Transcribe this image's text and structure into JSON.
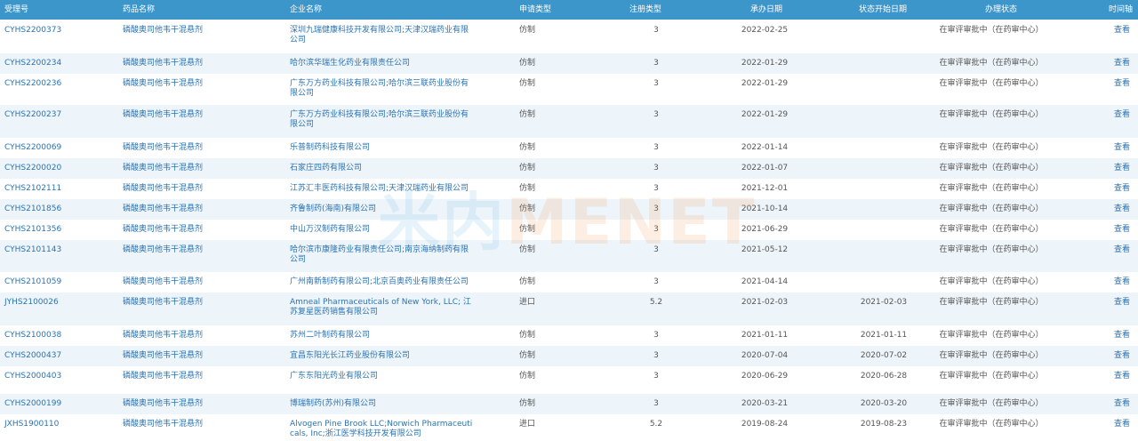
{
  "header": {
    "accept_no": "受理号",
    "drug_name": "药品名称",
    "company": "企业名称",
    "app_type": "申请类型",
    "reg_type": "注册类型",
    "undertake_date": "承办日期",
    "state_start": "状态开始日期",
    "status": "办理状态",
    "timeline": "时间轴"
  },
  "watermark": {
    "part1": "米内",
    "part2": "MENET"
  },
  "rows": [
    {
      "id": "CYHS2200373",
      "drug": "磷酸奥司他韦干混悬剂",
      "company": "深圳九瑞健康科技开发有限公司;天津汉瑞药业有限公司",
      "type": "仿制",
      "reg": "3",
      "date": "2022-02-25",
      "state": "",
      "status": "在审评审批中（在药审中心）",
      "view": "查看"
    },
    {
      "id": "CYHS2200234",
      "drug": "磷酸奥司他韦干混悬剂",
      "company": "哈尔滨华瑞生化药业有限责任公司",
      "type": "仿制",
      "reg": "3",
      "date": "2022-01-29",
      "state": "",
      "status": "在审评审批中（在药审中心）",
      "view": "查看"
    },
    {
      "id": "CYHS2200236",
      "drug": "磷酸奥司他韦干混悬剂",
      "company": "广东万方药业科技有限公司;哈尔滨三联药业股份有限公司",
      "type": "仿制",
      "reg": "3",
      "date": "2022-01-29",
      "state": "",
      "status": "在审评审批中（在药审中心）",
      "view": "查看"
    },
    {
      "id": "CYHS2200237",
      "drug": "磷酸奥司他韦干混悬剂",
      "company": "广东万方药业科技有限公司;哈尔滨三联药业股份有限公司",
      "type": "仿制",
      "reg": "3",
      "date": "2022-01-29",
      "state": "",
      "status": "在审评审批中（在药审中心）",
      "view": "查看"
    },
    {
      "id": "CYHS2200069",
      "drug": "磷酸奥司他韦干混悬剂",
      "company": "乐普制药科技有限公司",
      "type": "仿制",
      "reg": "3",
      "date": "2022-01-14",
      "state": "",
      "status": "在审评审批中（在药审中心）",
      "view": "查看"
    },
    {
      "id": "CYHS2200020",
      "drug": "磷酸奥司他韦干混悬剂",
      "company": "石家庄四药有限公司",
      "type": "仿制",
      "reg": "3",
      "date": "2022-01-07",
      "state": "",
      "status": "在审评审批中（在药审中心）",
      "view": "查看"
    },
    {
      "id": "CYHS2102111",
      "drug": "磷酸奥司他韦干混悬剂",
      "company": "江苏汇丰医药科技有限公司;天津汉瑞药业有限公司",
      "type": "仿制",
      "reg": "3",
      "date": "2021-12-01",
      "state": "",
      "status": "在审评审批中（在药审中心）",
      "view": "查看"
    },
    {
      "id": "CYHS2101856",
      "drug": "磷酸奥司他韦干混悬剂",
      "company": "齐鲁制药(海南)有限公司",
      "type": "仿制",
      "reg": "3",
      "date": "2021-10-14",
      "state": "",
      "status": "在审评审批中（在药审中心）",
      "view": "查看"
    },
    {
      "id": "CYHS2101356",
      "drug": "磷酸奥司他韦干混悬剂",
      "company": "中山万汉制药有限公司",
      "type": "仿制",
      "reg": "3",
      "date": "2021-06-29",
      "state": "",
      "status": "在审评审批中（在药审中心）",
      "view": "查看"
    },
    {
      "id": "CYHS2101143",
      "drug": "磷酸奥司他韦干混悬剂",
      "company": "哈尔滨市康隆药业有限责任公司;南京海纳制药有限公司",
      "type": "仿制",
      "reg": "3",
      "date": "2021-05-12",
      "state": "",
      "status": "在审评审批中（在药审中心）",
      "view": "查看"
    },
    {
      "id": "CYHS2101059",
      "drug": "磷酸奥司他韦干混悬剂",
      "company": "广州南新制药有限公司;北京百奥药业有限责任公司",
      "type": "仿制",
      "reg": "3",
      "date": "2021-04-14",
      "state": "",
      "status": "在审评审批中（在药审中心）",
      "view": "查看"
    },
    {
      "id": "JYHS2100026",
      "drug": "磷酸奥司他韦干混悬剂",
      "company": "Amneal Pharmaceuticals of New York, LLC; 江苏复星医药销售有限公司",
      "type": "进口",
      "reg": "5.2",
      "date": "2021-02-03",
      "state": "2021-02-03",
      "status": "在审评审批中（在药审中心）",
      "view": "查看"
    },
    {
      "id": "CYHS2100038",
      "drug": "磷酸奥司他韦干混悬剂",
      "company": "苏州二叶制药有限公司",
      "type": "仿制",
      "reg": "3",
      "date": "2021-01-11",
      "state": "2021-01-11",
      "status": "在审评审批中（在药审中心）",
      "view": "查看"
    },
    {
      "id": "CYHS2000437",
      "drug": "磷酸奥司他韦干混悬剂",
      "company": "宜昌东阳光长江药业股份有限公司",
      "type": "仿制",
      "reg": "3",
      "date": "2020-07-04",
      "state": "2020-07-02",
      "status": "在审评审批中（在药审中心）",
      "view": "查看"
    },
    {
      "id": "CYHS2000403",
      "drug": "磷酸奥司他韦干混悬剂",
      "company": "广东东阳光药业有限公司",
      "type": "仿制",
      "reg": "3",
      "date": "2020-06-29",
      "state": "2020-06-28",
      "status": "在审评审批中（在药审中心）",
      "view": "查看"
    },
    {
      "id": "CYHS2000199",
      "drug": "磷酸奥司他韦干混悬剂",
      "company": "博瑞制药(苏州)有限公司",
      "type": "仿制",
      "reg": "3",
      "date": "2020-03-21",
      "state": "2020-03-20",
      "status": "在审评审批中（在药审中心）",
      "view": "查看"
    },
    {
      "id": "JXHS1900110",
      "drug": "磷酸奥司他韦干混悬剂",
      "company": "Alvogen Pine Brook LLC;Norwich Pharmaceuticals, Inc;浙江医学科技开发有限公司",
      "type": "进口",
      "reg": "5.2",
      "date": "2019-08-24",
      "state": "2019-08-23",
      "status": "在审评审批中（在药审中心）",
      "view": "查看"
    }
  ]
}
